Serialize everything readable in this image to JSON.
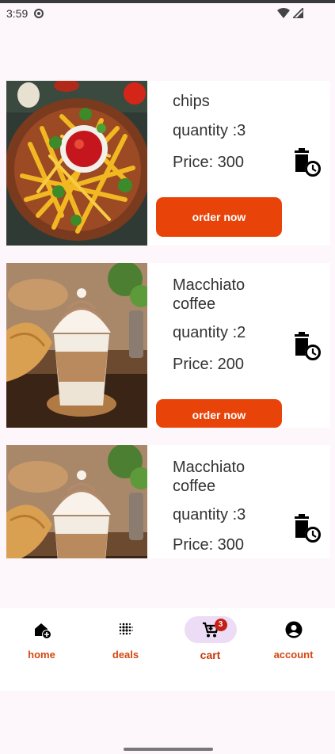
{
  "status_bar": {
    "time": "3:59"
  },
  "cart_items": [
    {
      "name": "chips",
      "quantity": "quantity :3",
      "price": "Price: 300",
      "order_label": "order now",
      "image": "fries-with-ketchup"
    },
    {
      "name": "Macchiato coffee",
      "quantity": "quantity :2",
      "price": "Price: 200",
      "order_label": "order now",
      "image": "macchiato-with-croissant"
    },
    {
      "name": "Macchiato coffee",
      "quantity": "quantity :3",
      "price": "Price: 300",
      "image": "macchiato-with-croissant"
    }
  ],
  "bottom_nav": {
    "items": [
      {
        "label": "home",
        "icon": "home-add-icon"
      },
      {
        "label": "deals",
        "icon": "dots-grid-icon"
      },
      {
        "label": "cart",
        "icon": "cart-icon",
        "badge": "3",
        "active": true
      },
      {
        "label": "account",
        "icon": "account-circle-icon"
      }
    ]
  },
  "colors": {
    "accent": "#e8440a",
    "nav_label": "#d4470f",
    "active_pill": "#ecdcf5",
    "badge": "#c42016",
    "background": "#fdf6fb"
  }
}
